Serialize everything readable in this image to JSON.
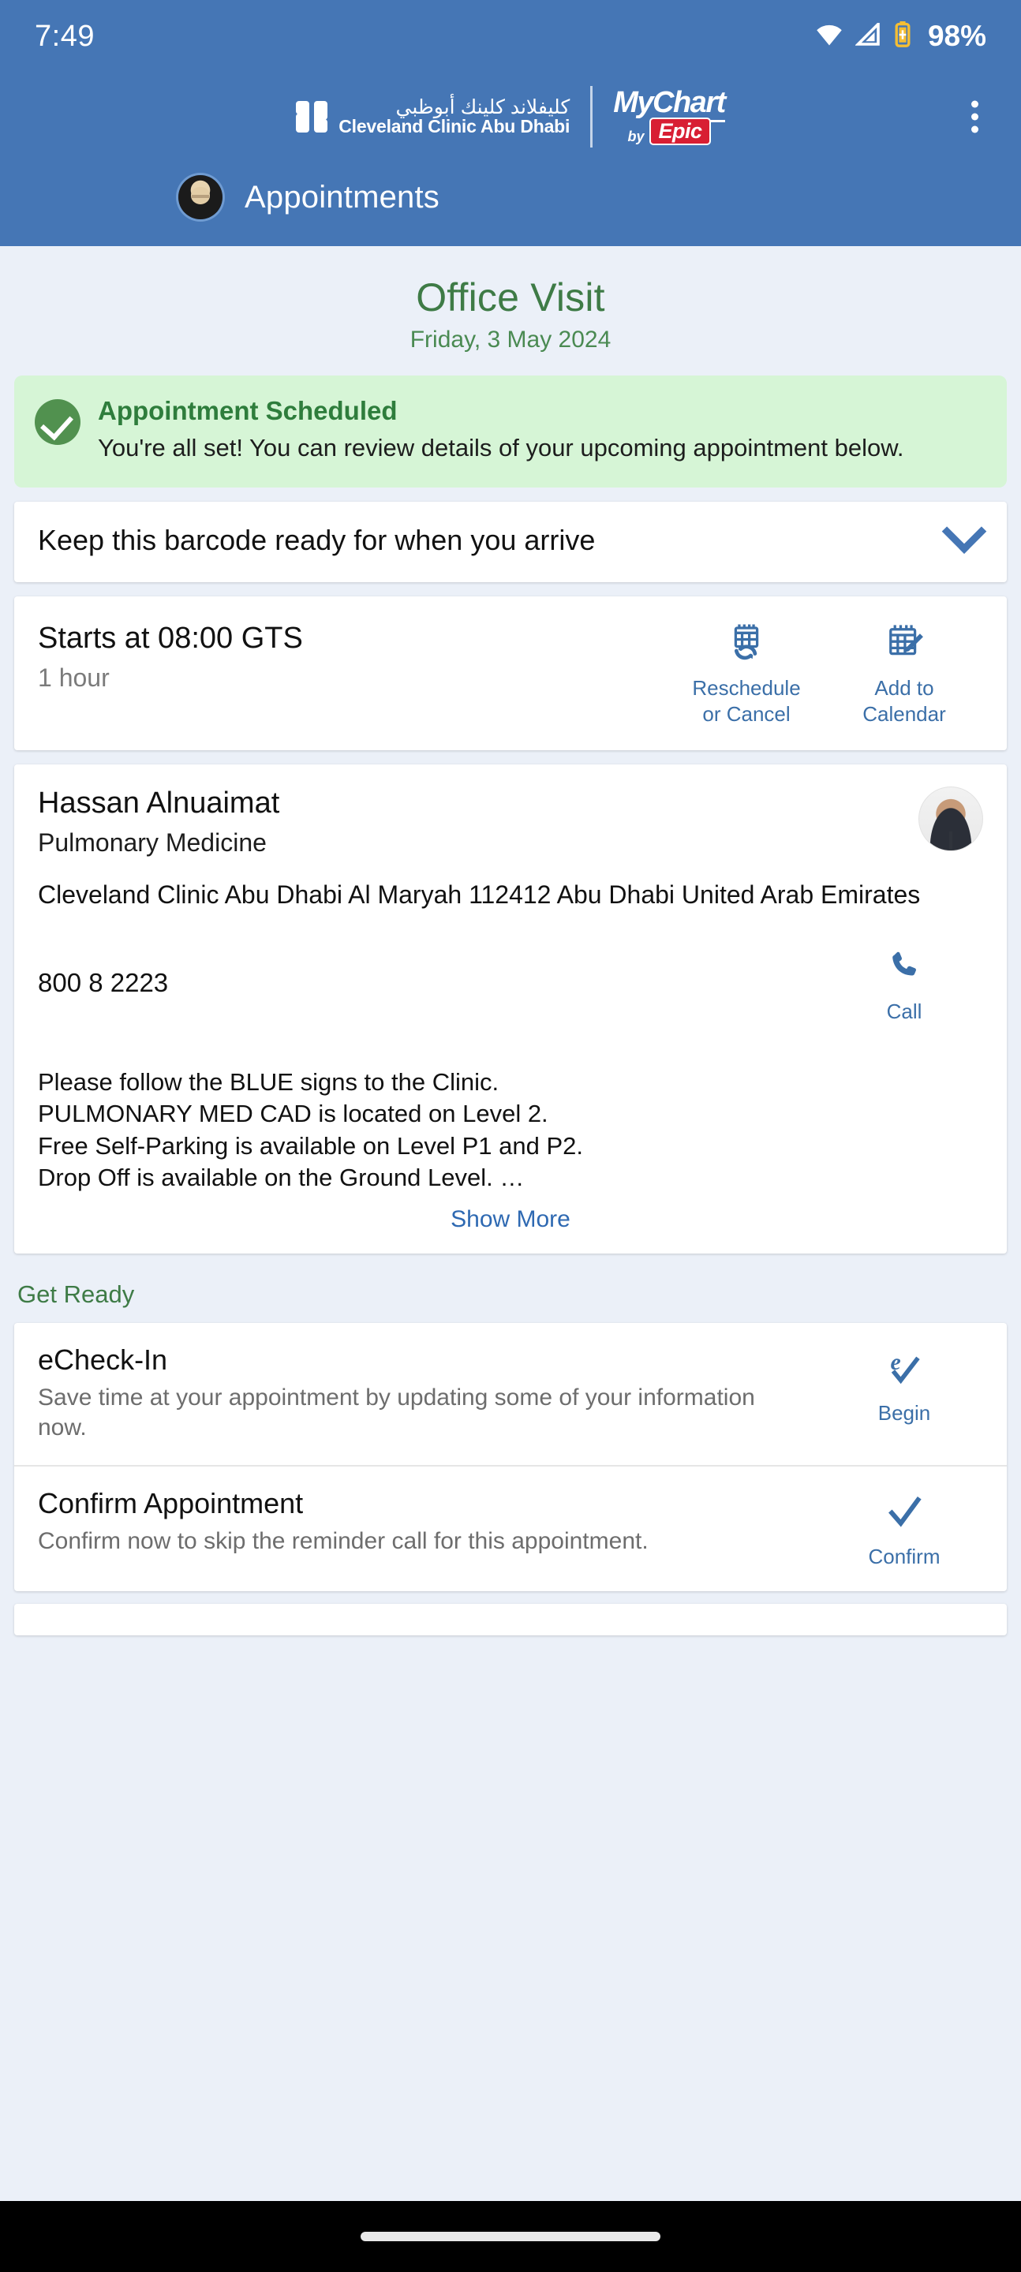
{
  "status_bar": {
    "time": "7:49",
    "battery_pct": "98%",
    "icons": [
      "wifi-icon",
      "signal-icon",
      "battery-charging-icon"
    ]
  },
  "header": {
    "clinic_name_ar": "كليفلاند كلينك أبوظبي",
    "clinic_name_en": "Cleveland Clinic Abu Dhabi",
    "mychart_my": "My",
    "mychart_chart": "Chart",
    "mychart_by": "by",
    "mychart_epic": "Epic",
    "overflow_menu": "overflow-menu",
    "page_title": "Appointments",
    "brand_blue": "#4576B5"
  },
  "visit": {
    "title": "Office Visit",
    "date": "Friday, 3 May 2024",
    "title_green": "#3E7B46"
  },
  "banner": {
    "title": "Appointment Scheduled",
    "text": "You're all set! You can review details of your upcoming appointment below.",
    "bg": "#D6F5D6",
    "check_color": "#51914F"
  },
  "barcode_card": {
    "text": "Keep this barcode ready for when you arrive",
    "expand_icon": "chevron-down-icon"
  },
  "time_card": {
    "starts_at": "Starts at 08:00 GTS",
    "duration": "1 hour",
    "actions": [
      {
        "label": "Reschedule\nor Cancel",
        "icon": "calendar-refresh-icon"
      },
      {
        "label": "Add to\nCalendar",
        "icon": "calendar-add-icon"
      }
    ]
  },
  "provider_card": {
    "name": "Hassan Alnuaimat",
    "specialty": "Pulmonary Medicine",
    "photo": "provider-photo",
    "address": "Cleveland Clinic Abu Dhabi Al Maryah 112412 Abu Dhabi United Arab Emirates",
    "phone": "800 8 2223",
    "call_label": "Call",
    "call_icon": "phone-icon",
    "instructions": "Please follow the BLUE signs to the Clinic.\nPULMONARY MED CAD is located on Level 2.\nFree Self-Parking is available on Level P1 and P2.\nDrop Off is available on the Ground Level. …",
    "show_more": "Show More"
  },
  "get_ready": {
    "heading": "Get Ready",
    "tasks": [
      {
        "title": "eCheck-In",
        "subtitle": "Save time at your appointment by updating some of your information now.",
        "action_label": "Begin",
        "icon": "echeckin-icon"
      },
      {
        "title": "Confirm Appointment",
        "subtitle": "Confirm now to skip the reminder call for this appointment.",
        "action_label": "Confirm",
        "icon": "checkmark-icon"
      }
    ]
  },
  "nav_bar": {
    "home_pill": "home-indicator"
  },
  "colors": {
    "link_blue": "#3B6FA8",
    "page_bg": "#EBF0F8"
  }
}
